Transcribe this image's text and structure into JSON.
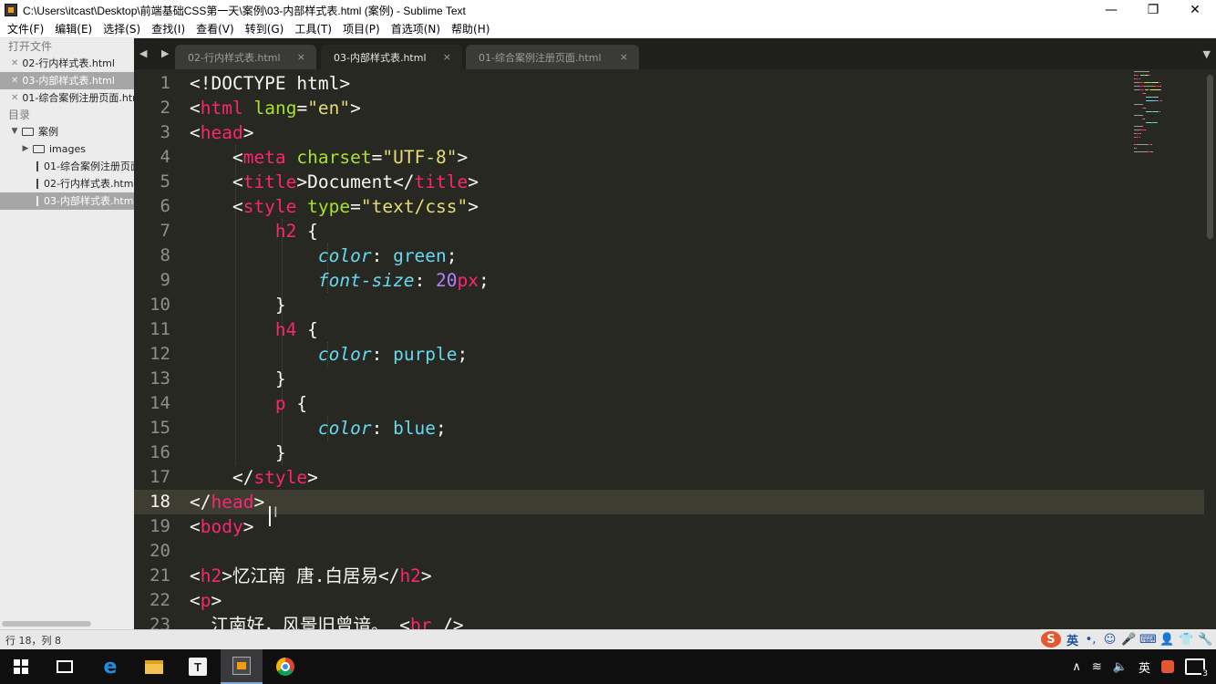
{
  "window": {
    "title": "C:\\Users\\itcast\\Desktop\\前端基础CSS第一天\\案例\\03-内部样式表.html (案例) - Sublime Text",
    "minimize": "—",
    "maximize": "❐",
    "close": "✕"
  },
  "menu": [
    "文件(F)",
    "编辑(E)",
    "选择(S)",
    "查找(I)",
    "查看(V)",
    "转到(G)",
    "工具(T)",
    "项目(P)",
    "首选项(N)",
    "帮助(H)"
  ],
  "sidebar": {
    "open_files_title": "打开文件",
    "open_files": [
      {
        "name": "02-行内样式表.html",
        "active": false
      },
      {
        "name": "03-内部样式表.html",
        "active": true
      },
      {
        "name": "01-综合案例注册页面.html",
        "active": false
      }
    ],
    "folders_title": "目录",
    "root_folder": "案例",
    "subfolder": "images",
    "files": [
      {
        "name": "01-综合案例注册页面.html",
        "active": false
      },
      {
        "name": "02-行内样式表.html",
        "active": false
      },
      {
        "name": "03-内部样式表.html",
        "active": true
      }
    ]
  },
  "tabs": [
    {
      "label": "02-行内样式表.html",
      "active": false,
      "close": "×"
    },
    {
      "label": "03-内部样式表.html",
      "active": true,
      "close": "×"
    },
    {
      "label": "01-综合案例注册页面.html",
      "active": false,
      "close": "×"
    }
  ],
  "tab_nav": "◀ ▶",
  "tab_dropdown": "▼",
  "editor": {
    "current_line": 18,
    "line_numbers": [
      "1",
      "2",
      "3",
      "4",
      "5",
      "6",
      "7",
      "8",
      "9",
      "10",
      "11",
      "12",
      "13",
      "14",
      "15",
      "16",
      "17",
      "18",
      "19",
      "20",
      "21",
      "22",
      "23"
    ],
    "lines": [
      [
        [
          "tx",
          "<!DOCTYPE html>"
        ]
      ],
      [
        [
          "tx",
          "<"
        ],
        [
          "tg",
          "html"
        ],
        [
          "tx",
          " "
        ],
        [
          "at",
          "lang"
        ],
        [
          "tx",
          "="
        ],
        [
          "st",
          "\"en\""
        ],
        [
          "tx",
          ">"
        ]
      ],
      [
        [
          "tx",
          "<"
        ],
        [
          "tg",
          "head"
        ],
        [
          "tx",
          ">"
        ]
      ],
      [
        [
          "tx",
          "    <"
        ],
        [
          "tg",
          "meta"
        ],
        [
          "tx",
          " "
        ],
        [
          "at",
          "charset"
        ],
        [
          "tx",
          "="
        ],
        [
          "st",
          "\"UTF-8\""
        ],
        [
          "tx",
          ">"
        ]
      ],
      [
        [
          "tx",
          "    <"
        ],
        [
          "tg",
          "title"
        ],
        [
          "tx",
          ">Document</"
        ],
        [
          "tg",
          "title"
        ],
        [
          "tx",
          ">"
        ]
      ],
      [
        [
          "tx",
          "    <"
        ],
        [
          "tg",
          "style"
        ],
        [
          "tx",
          " "
        ],
        [
          "at",
          "type"
        ],
        [
          "tx",
          "="
        ],
        [
          "st",
          "\"text/css\""
        ],
        [
          "tx",
          ">"
        ]
      ],
      [
        [
          "tx",
          "        "
        ],
        [
          "tg",
          "h2"
        ],
        [
          "tx",
          " {"
        ]
      ],
      [
        [
          "tx",
          "            "
        ],
        [
          "pr",
          "color"
        ],
        [
          "tx",
          ": "
        ],
        [
          "vl",
          "green"
        ],
        [
          "tx",
          ";"
        ]
      ],
      [
        [
          "tx",
          "            "
        ],
        [
          "pr",
          "font-size"
        ],
        [
          "tx",
          ": "
        ],
        [
          "nm",
          "20"
        ],
        [
          "tg",
          "px"
        ],
        [
          "tx",
          ";"
        ]
      ],
      [
        [
          "tx",
          "        }"
        ]
      ],
      [
        [
          "tx",
          "        "
        ],
        [
          "tg",
          "h4"
        ],
        [
          "tx",
          " {"
        ]
      ],
      [
        [
          "tx",
          "            "
        ],
        [
          "pr",
          "color"
        ],
        [
          "tx",
          ": "
        ],
        [
          "vl",
          "purple"
        ],
        [
          "tx",
          ";"
        ]
      ],
      [
        [
          "tx",
          "        }"
        ]
      ],
      [
        [
          "tx",
          "        "
        ],
        [
          "tg",
          "p"
        ],
        [
          "tx",
          " {"
        ]
      ],
      [
        [
          "tx",
          "            "
        ],
        [
          "pr",
          "color"
        ],
        [
          "tx",
          ": "
        ],
        [
          "vl",
          "blue"
        ],
        [
          "tx",
          ";"
        ]
      ],
      [
        [
          "tx",
          "        }"
        ]
      ],
      [
        [
          "tx",
          "    </"
        ],
        [
          "tg",
          "style"
        ],
        [
          "tx",
          ">"
        ]
      ],
      [
        [
          "tx",
          "</"
        ],
        [
          "tg",
          "head"
        ],
        [
          "tx",
          ">"
        ]
      ],
      [
        [
          "tx",
          "<"
        ],
        [
          "tg",
          "body"
        ],
        [
          "tx",
          ">"
        ]
      ],
      [
        [
          "tx",
          ""
        ]
      ],
      [
        [
          "tx",
          "<"
        ],
        [
          "tg",
          "h2"
        ],
        [
          "tx",
          ">忆江南 唐.白居易</"
        ],
        [
          "tg",
          "h2"
        ],
        [
          "tx",
          ">"
        ]
      ],
      [
        [
          "tx",
          "<"
        ],
        [
          "tg",
          "p"
        ],
        [
          "tx",
          ">"
        ]
      ],
      [
        [
          "tx",
          "  江南好，风景旧曾谙。 <"
        ],
        [
          "tg",
          "br"
        ],
        [
          "tx",
          " />"
        ]
      ]
    ]
  },
  "status": {
    "text": "行 18，列 8"
  },
  "ime": {
    "logo": "S",
    "mode": "英",
    "icons": [
      "•,",
      "☺",
      "🎤",
      "⌨",
      "👤",
      "👕",
      "🔧"
    ]
  },
  "taskbar": {
    "app_t": "T",
    "tray_up": "∧",
    "tray_lang": "英",
    "tray_badge": "3"
  }
}
